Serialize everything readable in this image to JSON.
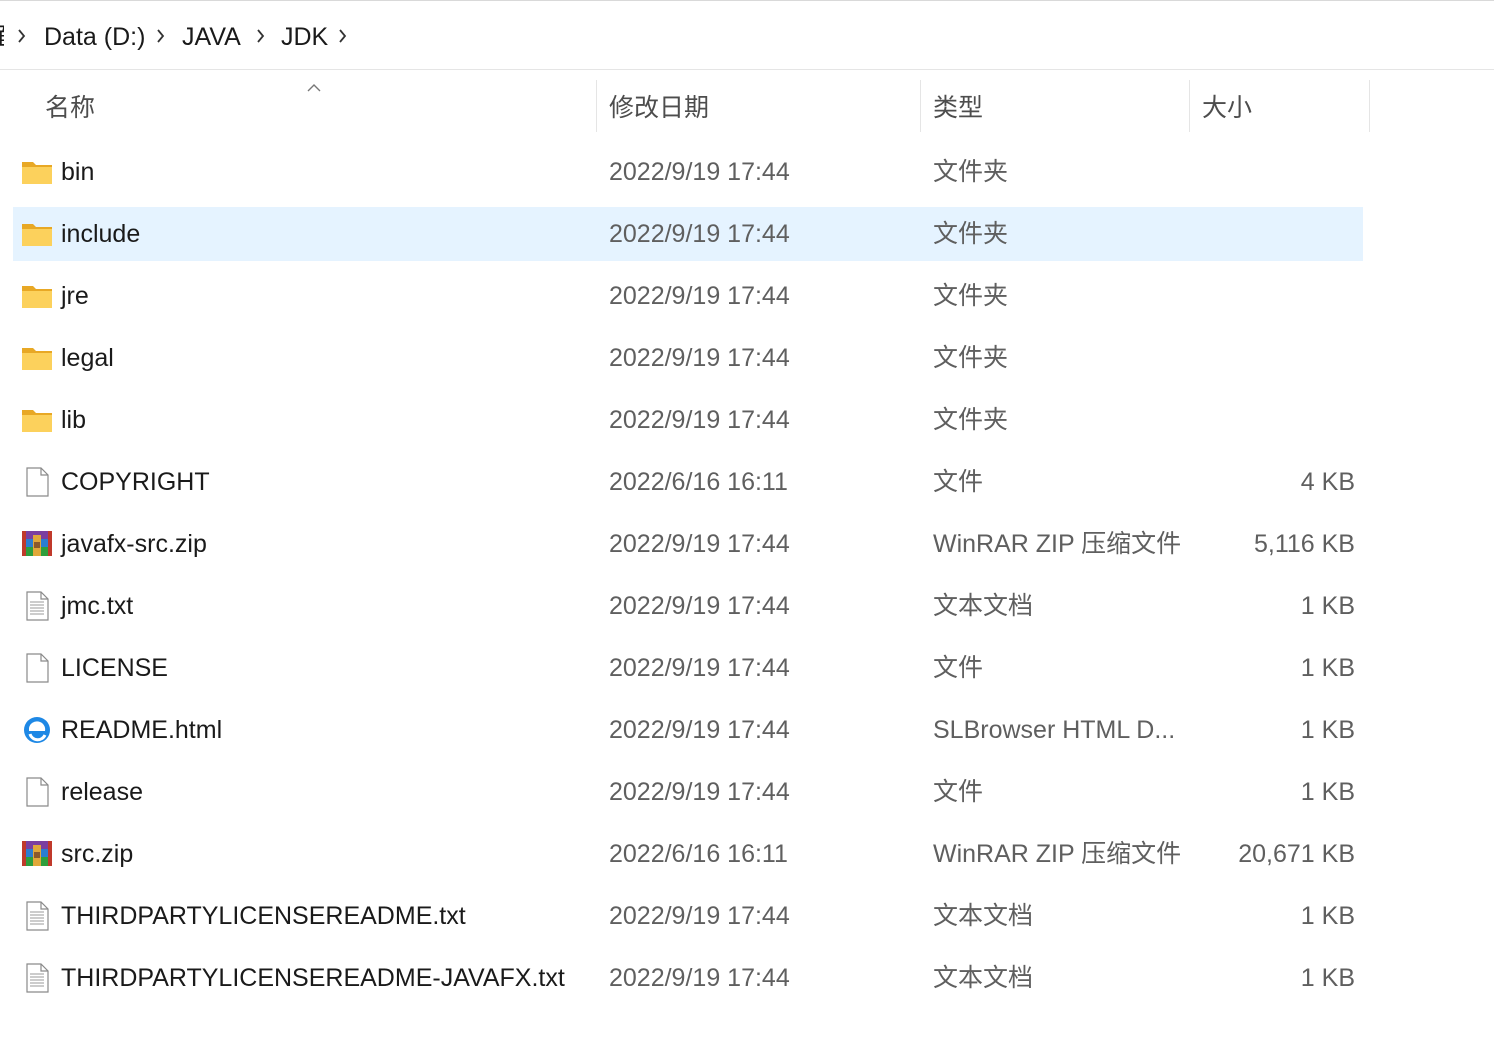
{
  "breadcrumb": {
    "partial_label": "面",
    "items": [
      "Data (D:)",
      "JAVA",
      "JDK"
    ]
  },
  "columns": {
    "name": "名称",
    "date": "修改日期",
    "type": "类型",
    "size": "大小"
  },
  "sort": {
    "column": "name",
    "direction": "ascending"
  },
  "files": [
    {
      "name": "bin",
      "date": "2022/9/19 17:44",
      "type": "文件夹",
      "size": "",
      "icon": "folder-icon"
    },
    {
      "name": "include",
      "date": "2022/9/19 17:44",
      "type": "文件夹",
      "size": "",
      "icon": "folder-icon",
      "selected": true
    },
    {
      "name": "jre",
      "date": "2022/9/19 17:44",
      "type": "文件夹",
      "size": "",
      "icon": "folder-icon"
    },
    {
      "name": "legal",
      "date": "2022/9/19 17:44",
      "type": "文件夹",
      "size": "",
      "icon": "folder-icon"
    },
    {
      "name": "lib",
      "date": "2022/9/19 17:44",
      "type": "文件夹",
      "size": "",
      "icon": "folder-icon"
    },
    {
      "name": "COPYRIGHT",
      "date": "2022/6/16 16:11",
      "type": "文件",
      "size": "4 KB",
      "icon": "file-icon"
    },
    {
      "name": "javafx-src.zip",
      "date": "2022/9/19 17:44",
      "type": "WinRAR ZIP 压缩文件",
      "size": "5,116 KB",
      "icon": "winrar-archive-icon"
    },
    {
      "name": "jmc.txt",
      "date": "2022/9/19 17:44",
      "type": "文本文档",
      "size": "1 KB",
      "icon": "text-file-icon"
    },
    {
      "name": "LICENSE",
      "date": "2022/9/19 17:44",
      "type": "文件",
      "size": "1 KB",
      "icon": "file-icon"
    },
    {
      "name": "README.html",
      "date": "2022/9/19 17:44",
      "type": "SLBrowser HTML D...",
      "size": "1 KB",
      "icon": "browser-html-icon"
    },
    {
      "name": "release",
      "date": "2022/9/19 17:44",
      "type": "文件",
      "size": "1 KB",
      "icon": "file-icon"
    },
    {
      "name": "src.zip",
      "date": "2022/6/16 16:11",
      "type": "WinRAR ZIP 压缩文件",
      "size": "20,671 KB",
      "icon": "winrar-archive-icon"
    },
    {
      "name": "THIRDPARTYLICENSEREADME.txt",
      "date": "2022/9/19 17:44",
      "type": "文本文档",
      "size": "1 KB",
      "icon": "text-file-icon"
    },
    {
      "name": "THIRDPARTYLICENSEREADME-JAVAFX.txt",
      "date": "2022/9/19 17:44",
      "type": "文本文档",
      "size": "1 KB",
      "icon": "text-file-icon"
    }
  ],
  "colors": {
    "selection": "#e5f3ff",
    "folder": "#f8c642",
    "text_secondary": "#5f5f5f"
  }
}
